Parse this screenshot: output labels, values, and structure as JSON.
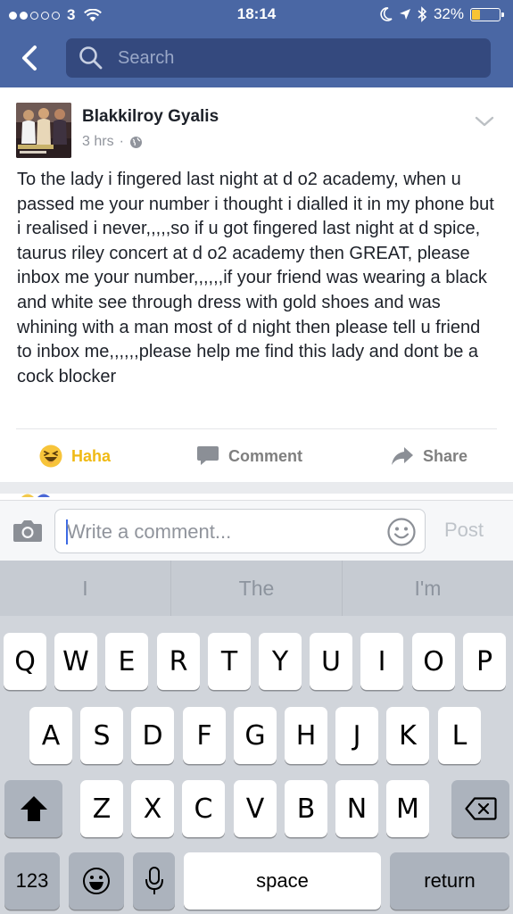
{
  "status_bar": {
    "carrier": "3",
    "time": "18:14",
    "battery": "32%",
    "battery_level": 0.32
  },
  "nav": {
    "back_icon": "chevron-left-icon",
    "search_placeholder": "Search"
  },
  "post": {
    "author": "Blakkilroy Gyalis",
    "time": "3 hrs",
    "separator": "·",
    "body": "To the lady i fingered last night at d o2 academy, when u passed me your number i thought i dialled it in my phone but i realised i never,,,,,so if u got fingered last night at d spice, taurus riley concert at d o2 academy then GREAT, please inbox me your number,,,,,,if your friend was wearing a black and white see through dress with gold shoes and was whining with a man most of d night then please tell u friend to inbox me,,,,,,please help me find this lady and dont be a cock blocker",
    "actions": {
      "haha": "Haha",
      "comment": "Comment",
      "share": "Share"
    }
  },
  "comment_bar": {
    "placeholder": "Write a comment...",
    "post_label": "Post"
  },
  "keyboard": {
    "suggestions": [
      "I",
      "The",
      "I'm"
    ],
    "row1": [
      "Q",
      "W",
      "E",
      "R",
      "T",
      "Y",
      "U",
      "I",
      "O",
      "P"
    ],
    "row2": [
      "A",
      "S",
      "D",
      "F",
      "G",
      "H",
      "J",
      "K",
      "L"
    ],
    "row3": [
      "Z",
      "X",
      "C",
      "V",
      "B",
      "N",
      "M"
    ],
    "numbers_label": "123",
    "space_label": "space",
    "return_label": "return"
  },
  "colors": {
    "facebook_blue": "#4a67a4",
    "haha_yellow": "#f0ba15"
  }
}
